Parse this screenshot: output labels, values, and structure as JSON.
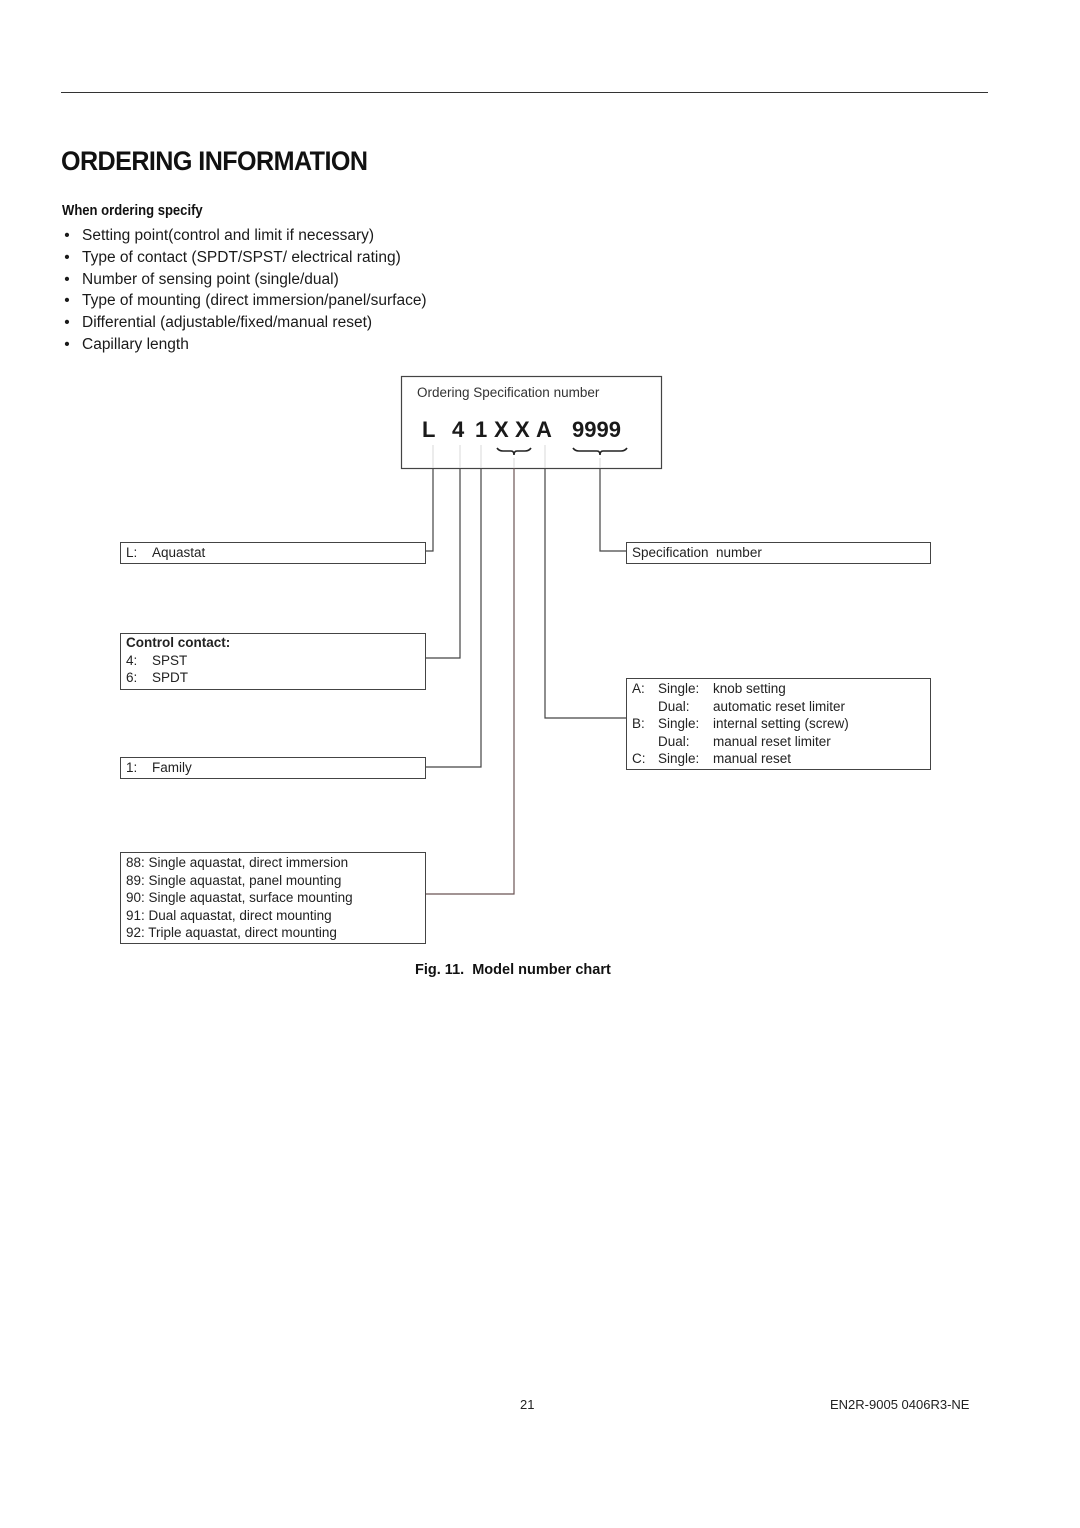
{
  "page": {
    "title": "ORDERING INFORMATION",
    "section_heading": "When ordering specify",
    "bullets": [
      "Setting point(control and limit if necessary)",
      "Type of contact (SPDT/SPST/ electrical rating)",
      "Number of sensing point (single/dual)",
      "Type of mounting (direct immersion/panel/surface)",
      "Differential (adjustable/fixed/manual reset)",
      "Capillary length"
    ],
    "bullet_glyph": "•"
  },
  "diagram": {
    "spec_box_title": "Ordering Specification number",
    "code": {
      "c1": "L",
      "c2": "4",
      "c3": "1",
      "c4": "X",
      "c5": "X",
      "c6": "A",
      "c7": "9999"
    },
    "aquastat": {
      "key": "L:",
      "label": "Aquastat"
    },
    "spec_number": {
      "label": "Specification  number"
    },
    "control_contact": {
      "heading": "Control contact:",
      "items": [
        {
          "key": "4:",
          "label": "SPST"
        },
        {
          "key": "6:",
          "label": "SPDT"
        }
      ]
    },
    "family": {
      "key": "1:",
      "label": "Family"
    },
    "differential": {
      "rows": [
        {
          "key": "A:",
          "type": "Single:",
          "label": "knob setting"
        },
        {
          "key": "",
          "type": "Dual:",
          "label": "automatic reset limiter"
        },
        {
          "key": "B:",
          "type": "Single:",
          "label": "internal setting (screw)"
        },
        {
          "key": "",
          "type": "Dual:",
          "label": "manual reset limiter"
        },
        {
          "key": "C:",
          "type": "Single:",
          "label": "manual reset"
        }
      ]
    },
    "mounting": {
      "items": [
        "88: Single aquastat, direct immersion",
        "89: Single aquastat, panel mounting",
        "90: Single aquastat, surface mounting",
        "91: Dual aquastat, direct mounting",
        "92: Triple aquastat, direct mounting"
      ]
    }
  },
  "caption": "Fig. 11.  Model number chart",
  "footer": {
    "page_number": "21",
    "doc_id": "EN2R-9005 0406R3-NE"
  }
}
